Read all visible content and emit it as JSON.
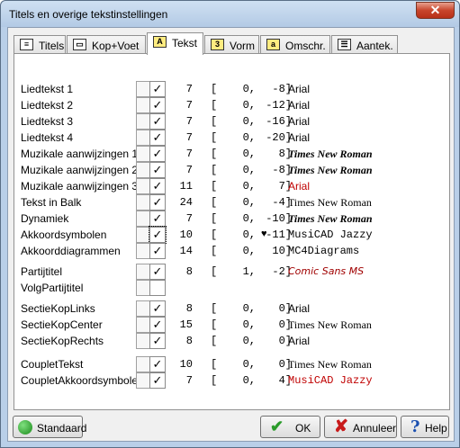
{
  "window": {
    "title": "Titels en overige tekstinstellingen",
    "close": "✕"
  },
  "tabs": [
    {
      "label": "Titels",
      "icon": "titles-icon"
    },
    {
      "label": "Kop+Voet",
      "icon": "header-footer-icon"
    },
    {
      "label": "Tekst",
      "icon": "text-a-icon",
      "glyph": "A"
    },
    {
      "label": "Vorm",
      "icon": "form-3-icon",
      "glyph": "3"
    },
    {
      "label": "Omschr.",
      "icon": "description-icon",
      "glyph": "a"
    },
    {
      "label": "Aantek.",
      "icon": "annotation-icon"
    }
  ],
  "rows": [
    {
      "label": "Liedtekst 1",
      "checked": true,
      "size": "7",
      "x": "0,",
      "y": "-8]",
      "font": "Arial",
      "style": "arial",
      "color": "black"
    },
    {
      "label": "Liedtekst 2",
      "checked": true,
      "size": "7",
      "x": "0,",
      "y": "-12]",
      "font": "Arial",
      "style": "arial",
      "color": "black"
    },
    {
      "label": "Liedtekst 3",
      "checked": true,
      "size": "7",
      "x": "0,",
      "y": "-16]",
      "font": "Arial",
      "style": "arial",
      "color": "black"
    },
    {
      "label": "Liedtekst 4",
      "checked": true,
      "size": "7",
      "x": "0,",
      "y": "-20]",
      "font": "Arial",
      "style": "arial",
      "color": "black"
    },
    {
      "label": "Muzikale aanwijzingen 1",
      "checked": true,
      "size": "7",
      "x": "0,",
      "y": "8]",
      "font": "Times New Roman",
      "style": "tnrbi",
      "color": "black"
    },
    {
      "label": "Muzikale aanwijzingen 2",
      "checked": true,
      "size": "7",
      "x": "0,",
      "y": "-8]",
      "font": "Times New Roman",
      "style": "tnrbi",
      "color": "black"
    },
    {
      "label": "Muzikale aanwijzingen 3",
      "checked": true,
      "size": "11",
      "x": "0,",
      "y": "7]",
      "font": "Arial",
      "style": "arial",
      "color": "red"
    },
    {
      "label": "Tekst in Balk",
      "checked": true,
      "size": "24",
      "x": "0,",
      "y": "-4]",
      "font": "Times New Roman",
      "style": "tnr",
      "color": "black"
    },
    {
      "label": "Dynamiek",
      "checked": true,
      "size": "7",
      "x": "0,",
      "y": "-10]",
      "font": "Times New Roman",
      "style": "tnrbi",
      "color": "black"
    },
    {
      "label": "Akkoordsymbolen",
      "checked": true,
      "focused": true,
      "heart": "♥",
      "size": "10",
      "x": "0,",
      "y": "-11]",
      "font": "MusiCAD Jazzy",
      "style": "mono",
      "color": "black"
    },
    {
      "label": "Akkoorddiagrammen",
      "checked": true,
      "size": "14",
      "x": "0,",
      "y": "10]",
      "font": "MC4Diagrams",
      "style": "mono",
      "color": "black"
    },
    {
      "label": "Partijtitel",
      "checked": true,
      "size": "8",
      "x": "1,",
      "y": "-2]",
      "font": "Comic Sans MS",
      "style": "comic",
      "color": "darkred"
    },
    {
      "label": "VolgPartijtitel",
      "checked": false,
      "size": "",
      "x": "",
      "y": "",
      "font": "",
      "style": "arial",
      "color": "black"
    },
    {
      "label": "SectieKopLinks",
      "checked": true,
      "size": "8",
      "x": "0,",
      "y": "0]",
      "font": "Arial",
      "style": "arial",
      "color": "black"
    },
    {
      "label": "SectieKopCenter",
      "checked": true,
      "size": "15",
      "x": "0,",
      "y": "0]",
      "font": "Times New Roman",
      "style": "tnr",
      "color": "black"
    },
    {
      "label": "SectieKopRechts",
      "checked": true,
      "size": "8",
      "x": "0,",
      "y": "0]",
      "font": "Arial",
      "style": "arial",
      "color": "black"
    },
    {
      "label": "CoupletTekst",
      "checked": true,
      "size": "10",
      "x": "0,",
      "y": "0]",
      "font": "Times New Roman",
      "style": "tnr",
      "color": "black"
    },
    {
      "label": "CoupletAkkoordsymbolen",
      "checked": true,
      "size": "7",
      "x": "0,",
      "y": "4]",
      "font": "MusiCAD Jazzy",
      "style": "mono",
      "color": "red"
    }
  ],
  "checkmark": "✓",
  "open_bracket": "[",
  "buttons": {
    "standaard": "Standaard",
    "ok": "OK",
    "annuleer": "Annuleer",
    "help": "Help"
  }
}
